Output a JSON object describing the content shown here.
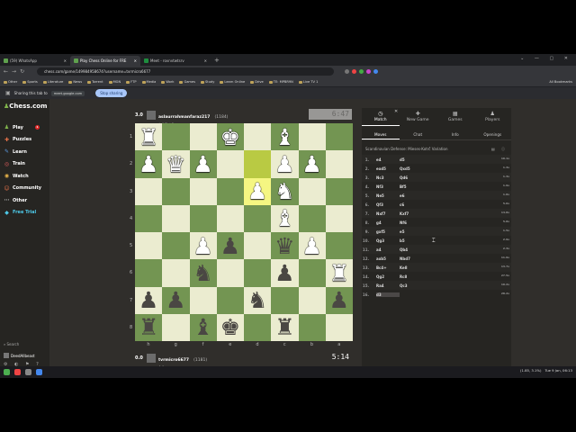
{
  "browser": {
    "tabs": [
      {
        "title": "(59) WhatsApp",
        "active": false
      },
      {
        "title": "Play Chess Online for FRE",
        "active": true
      },
      {
        "title": "Meet - rovnvtwtsrv",
        "active": false
      }
    ],
    "url": "chess.com/game/149984958674?username=tvrmicro6677",
    "bookmarks": [
      "Other",
      "Sports",
      "Literature",
      "News",
      "Torrent",
      "MGN",
      "FTP",
      "Media",
      "Work",
      "Games",
      "Study",
      "Learn Online",
      "Drive",
      "TE: MPBR9N",
      "Live TV 1"
    ],
    "all_bookmarks": "All Bookmarks",
    "sharing_text": "Sharing this tab to",
    "sharing_url": "meet.google.com",
    "stop_sharing": "Stop sharing"
  },
  "sidebar": {
    "logo_text": "Chess.com",
    "items": [
      {
        "label": "Play",
        "icon": "♟",
        "color": "#81b64c",
        "badge": "1"
      },
      {
        "label": "Puzzles",
        "icon": "✚",
        "color": "#e8734a",
        "badge": ""
      },
      {
        "label": "Learn",
        "icon": "✎",
        "color": "#5d9ce3",
        "badge": ""
      },
      {
        "label": "Train",
        "icon": "◎",
        "color": "#e35d5d",
        "badge": ""
      },
      {
        "label": "Watch",
        "icon": "◉",
        "color": "#e8b44a",
        "badge": ""
      },
      {
        "label": "Community",
        "icon": "☺",
        "color": "#e8734a",
        "badge": ""
      },
      {
        "label": "Other",
        "icon": "⋯",
        "color": "#aaaaaa",
        "badge": ""
      },
      {
        "label": "Free Trial",
        "icon": "◆",
        "color": "#4ec9e8",
        "badge": ""
      }
    ],
    "search": "Search",
    "user": "DeedAllbeast"
  },
  "players": {
    "top": {
      "score": "3.0",
      "name": "aslaurrahmanfaraz217",
      "rating": "(1184)",
      "clock": "6:47",
      "captured": "♘♗♖ +3"
    },
    "bottom": {
      "score": "0.0",
      "name": "tvrmicro6677",
      "rating": "(1181)",
      "clock": "5:14",
      "captured": "♙♟"
    }
  },
  "board": {
    "ranks": [
      "1",
      "2",
      "3",
      "4",
      "5",
      "6",
      "7",
      "8"
    ],
    "files": [
      "h",
      "g",
      "f",
      "e",
      "d",
      "c",
      "b",
      "a"
    ],
    "pieces": [
      {
        "row": 0,
        "col": 0,
        "glyph": "♜",
        "side": "w"
      },
      {
        "row": 0,
        "col": 3,
        "glyph": "♚",
        "side": "w"
      },
      {
        "row": 0,
        "col": 5,
        "glyph": "♝",
        "side": "w"
      },
      {
        "row": 1,
        "col": 0,
        "glyph": "♟",
        "side": "w"
      },
      {
        "row": 1,
        "col": 1,
        "glyph": "♛",
        "side": "w"
      },
      {
        "row": 1,
        "col": 2,
        "glyph": "♟",
        "side": "w"
      },
      {
        "row": 1,
        "col": 5,
        "glyph": "♟",
        "side": "w"
      },
      {
        "row": 1,
        "col": 6,
        "glyph": "♟",
        "side": "w"
      },
      {
        "row": 2,
        "col": 4,
        "glyph": "♟",
        "side": "w"
      },
      {
        "row": 2,
        "col": 5,
        "glyph": "♞",
        "side": "w"
      },
      {
        "row": 3,
        "col": 5,
        "glyph": "♝",
        "side": "w"
      },
      {
        "row": 4,
        "col": 2,
        "glyph": "♟",
        "side": "w"
      },
      {
        "row": 4,
        "col": 3,
        "glyph": "♟",
        "side": "b"
      },
      {
        "row": 4,
        "col": 5,
        "glyph": "♛",
        "side": "b"
      },
      {
        "row": 4,
        "col": 6,
        "glyph": "♟",
        "side": "w"
      },
      {
        "row": 5,
        "col": 2,
        "glyph": "♞",
        "side": "b"
      },
      {
        "row": 5,
        "col": 5,
        "glyph": "♟",
        "side": "b"
      },
      {
        "row": 5,
        "col": 7,
        "glyph": "♜",
        "side": "w"
      },
      {
        "row": 6,
        "col": 0,
        "glyph": "♟",
        "side": "b"
      },
      {
        "row": 6,
        "col": 1,
        "glyph": "♟",
        "side": "b"
      },
      {
        "row": 6,
        "col": 4,
        "glyph": "♞",
        "side": "b"
      },
      {
        "row": 6,
        "col": 7,
        "glyph": "♟",
        "side": "b"
      },
      {
        "row": 7,
        "col": 0,
        "glyph": "♜",
        "side": "b"
      },
      {
        "row": 7,
        "col": 2,
        "glyph": "♝",
        "side": "b"
      },
      {
        "row": 7,
        "col": 3,
        "glyph": "♚",
        "side": "b"
      },
      {
        "row": 7,
        "col": 5,
        "glyph": "♜",
        "side": "b"
      }
    ],
    "highlight": [
      {
        "row": 1,
        "col": 4,
        "tone": "hl"
      },
      {
        "row": 2,
        "col": 4,
        "tone": "hll"
      }
    ]
  },
  "panel": {
    "tabs": [
      {
        "label": "Match",
        "icon": "◷",
        "active": true
      },
      {
        "label": "New Game",
        "icon": "✚",
        "active": false
      },
      {
        "label": "Games",
        "icon": "▦",
        "active": false
      },
      {
        "label": "Players",
        "icon": "♟",
        "active": false
      }
    ],
    "subtabs": [
      {
        "label": "Moves",
        "active": true
      },
      {
        "label": "Chat",
        "active": false
      },
      {
        "label": "Info",
        "active": false
      },
      {
        "label": "Openings",
        "active": false
      }
    ],
    "opening": "Scandinavian Defense: Mieses-Kotrč Variation",
    "moves": [
      {
        "n": "1.",
        "w": "e4",
        "b": "d5",
        "t": "10.1s"
      },
      {
        "n": "2.",
        "w": "exd5",
        "b": "Qxd5",
        "t": "1.3s"
      },
      {
        "n": "3.",
        "w": "Nc3",
        "b": "Qd6",
        "t": "1.3s"
      },
      {
        "n": "4.",
        "w": "Nf3",
        "b": "Bf5",
        "t": "1.9s"
      },
      {
        "n": "5.",
        "w": "Ne5",
        "b": "e6",
        "t": "1.8s"
      },
      {
        "n": "6.",
        "w": "Qf3",
        "b": "c6",
        "t": "5.0s"
      },
      {
        "n": "7.",
        "w": "Nxf7",
        "b": "Kxf7",
        "t": "14.8s"
      },
      {
        "n": "8.",
        "w": "g4",
        "b": "Nf6",
        "t": "5.8s"
      },
      {
        "n": "9.",
        "w": "gxf5",
        "b": "e5",
        "t": "1.5s"
      },
      {
        "n": "10.",
        "w": "Qg3",
        "b": "b5",
        "t": "2.9s"
      },
      {
        "n": "11.",
        "w": "a4",
        "b": "Qb4",
        "t": "2.3s"
      },
      {
        "n": "12.",
        "w": "axb5",
        "b": "Nbd7",
        "t": "11.9s"
      },
      {
        "n": "13.",
        "w": "Bc4+",
        "b": "Ke8",
        "t": "13.7s"
      },
      {
        "n": "14.",
        "w": "Qg2",
        "b": "Rc8",
        "t": "27.5s"
      },
      {
        "n": "15.",
        "w": "Ra4",
        "b": "Qc3",
        "t": "10.2s"
      },
      {
        "n": "16.",
        "w": "d3",
        "b": "",
        "t": "28.2s"
      }
    ],
    "controls": [
      "⏮",
      "◀",
      "▶",
      "▷",
      "⏭"
    ]
  },
  "taskbar": {
    "clock": "Tue 9 Jan, 06:13",
    "tray": "(1.85, 3.1%)"
  }
}
